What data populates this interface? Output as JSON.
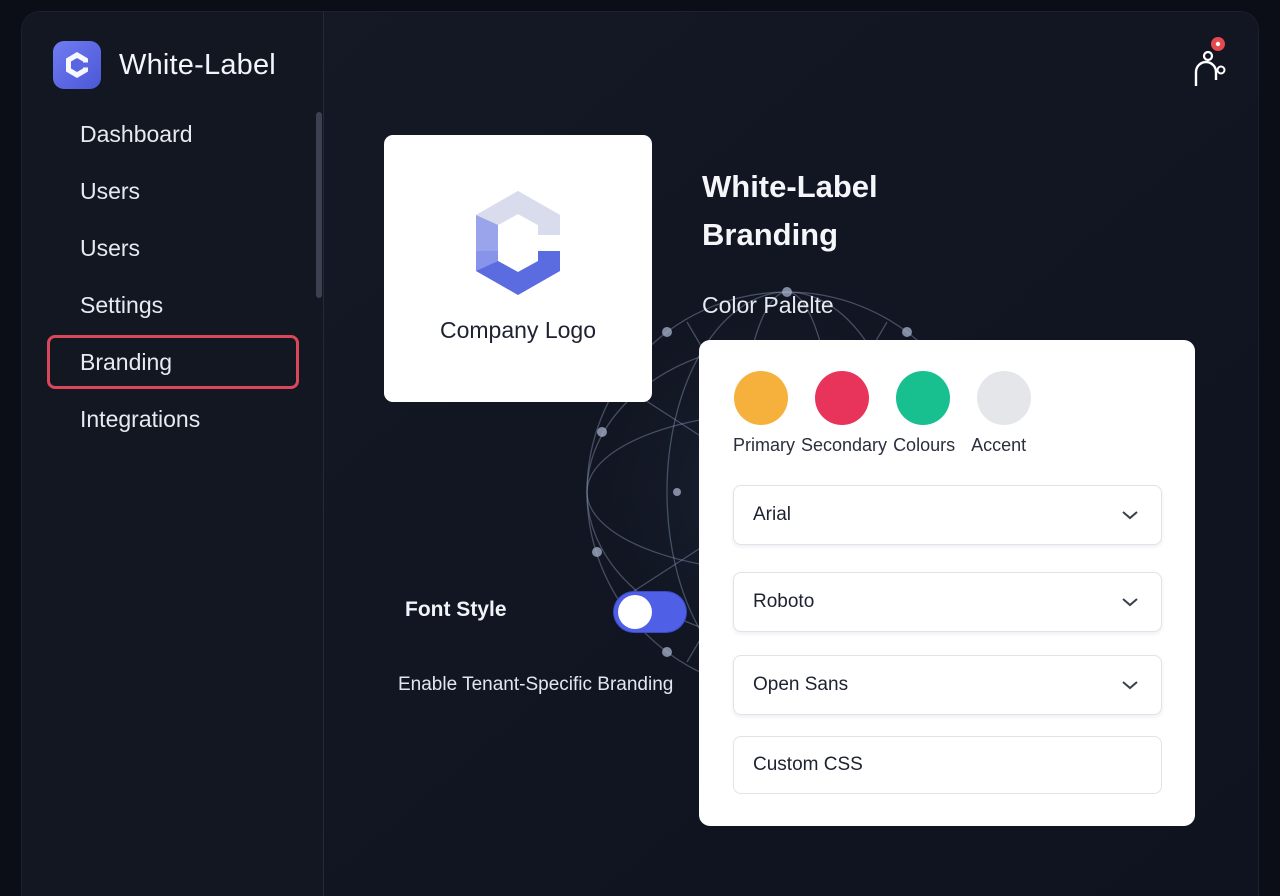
{
  "app": {
    "title": "White-Label"
  },
  "sidebar": {
    "items": [
      {
        "label": "Dashboard",
        "active": false
      },
      {
        "label": "Users",
        "active": false
      },
      {
        "label": "Users",
        "active": false
      },
      {
        "label": "Settings",
        "active": false
      },
      {
        "label": "Branding",
        "active": true
      },
      {
        "label": "Integrations",
        "active": false
      }
    ]
  },
  "header": {
    "user_icon": "user-icon",
    "notification_badge_color": "#e5484d"
  },
  "logo_card": {
    "caption": "Company Logo"
  },
  "main": {
    "title_line1": "White-Label",
    "title_line2": "Branding",
    "palette_label": "Color Palelte"
  },
  "palette": {
    "swatches": [
      {
        "color": "#f6b13d"
      },
      {
        "color": "#e8345a"
      },
      {
        "color": "#18c08f"
      },
      {
        "color": "#e4e6ea"
      }
    ],
    "labels": [
      "Primary",
      "Secondary",
      "Colours",
      "Accent"
    ]
  },
  "fields": {
    "font1": "Arial",
    "font2": "Roboto",
    "font3": "Open Sans",
    "custom_css": "Custom CSS"
  },
  "font_style": {
    "label": "Font Style",
    "toggle_on": true
  },
  "tenant": {
    "label": "Enable Tenant-Specific Branding"
  },
  "colors": {
    "accent": "#4f5fe6",
    "active_outline": "#d9475a",
    "background": "#0b0e16"
  }
}
